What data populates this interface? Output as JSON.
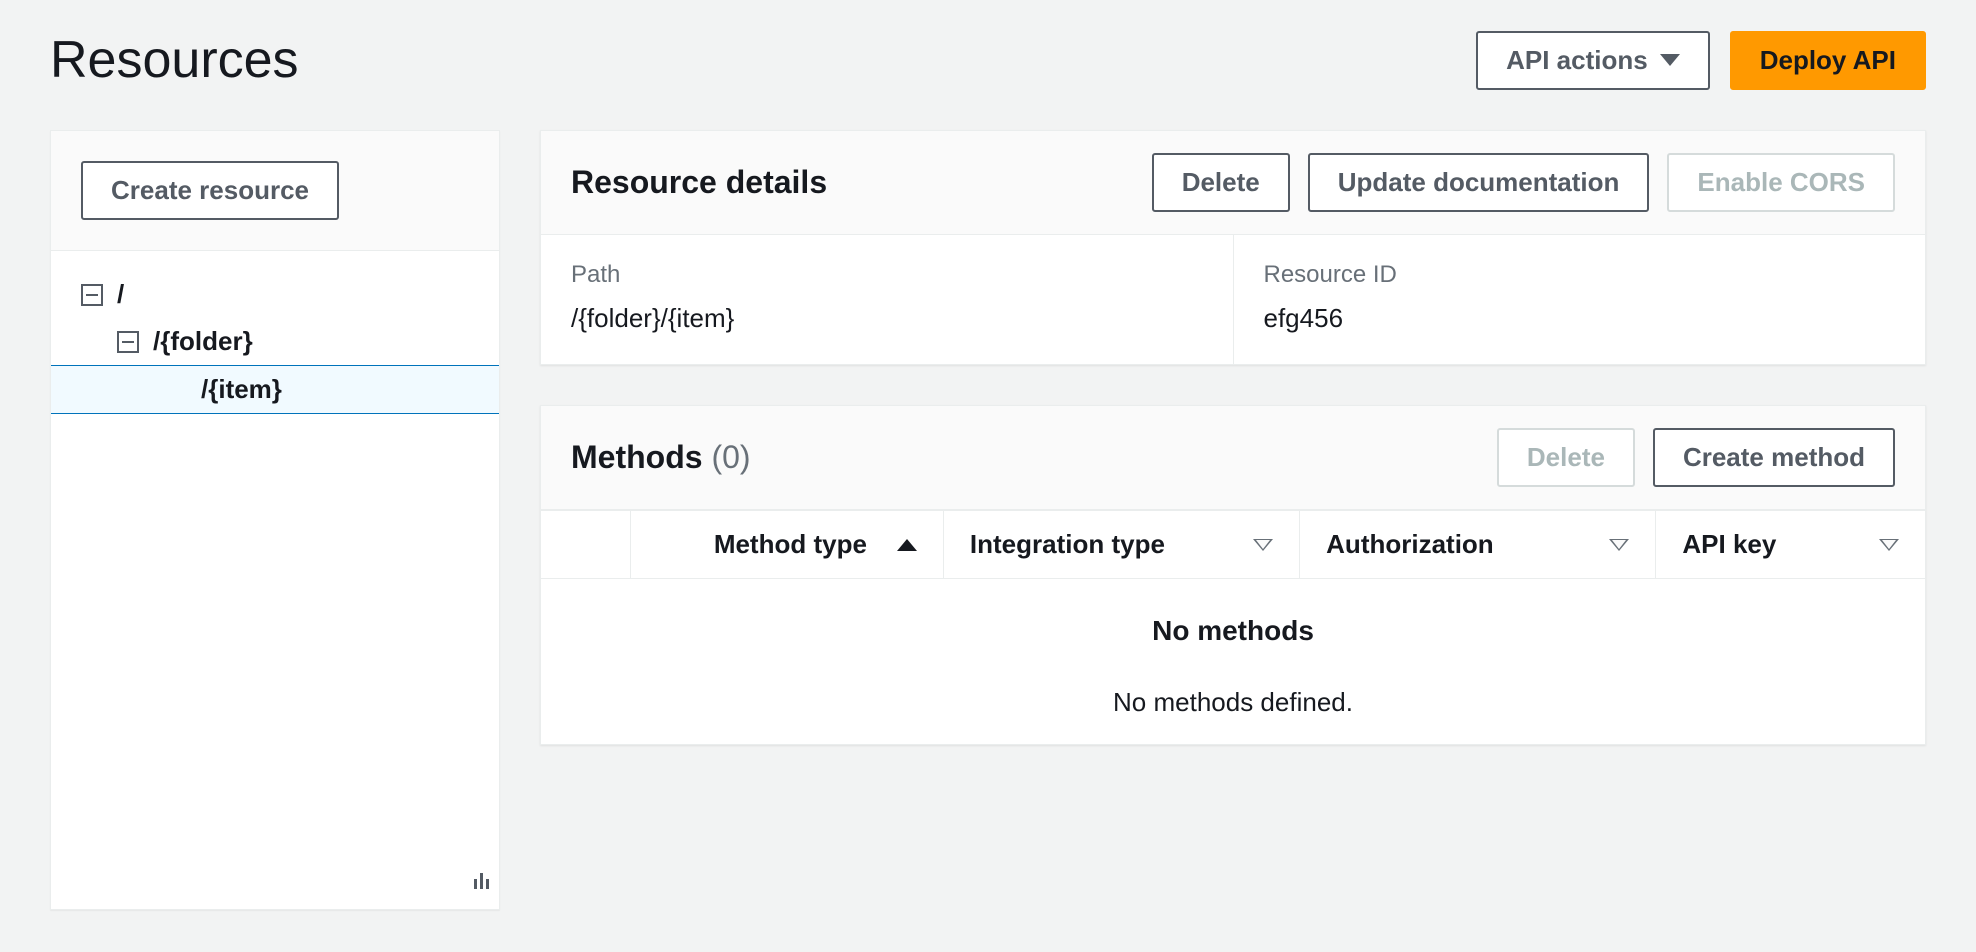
{
  "header": {
    "title": "Resources",
    "api_actions_label": "API actions",
    "deploy_label": "Deploy API"
  },
  "sidebar": {
    "create_resource_label": "Create resource",
    "tree": {
      "root": "/",
      "folder": "/{folder}",
      "item": "/{item}"
    }
  },
  "details": {
    "title": "Resource details",
    "delete_label": "Delete",
    "update_doc_label": "Update documentation",
    "enable_cors_label": "Enable CORS",
    "path_label": "Path",
    "path_value": "/{folder}/{item}",
    "resource_id_label": "Resource ID",
    "resource_id_value": "efg456"
  },
  "methods": {
    "title": "Methods",
    "count": "(0)",
    "delete_label": "Delete",
    "create_label": "Create method",
    "columns": {
      "method_type": "Method type",
      "integration_type": "Integration type",
      "authorization": "Authorization",
      "api_key": "API key"
    },
    "empty_title": "No methods",
    "empty_sub": "No methods defined."
  }
}
